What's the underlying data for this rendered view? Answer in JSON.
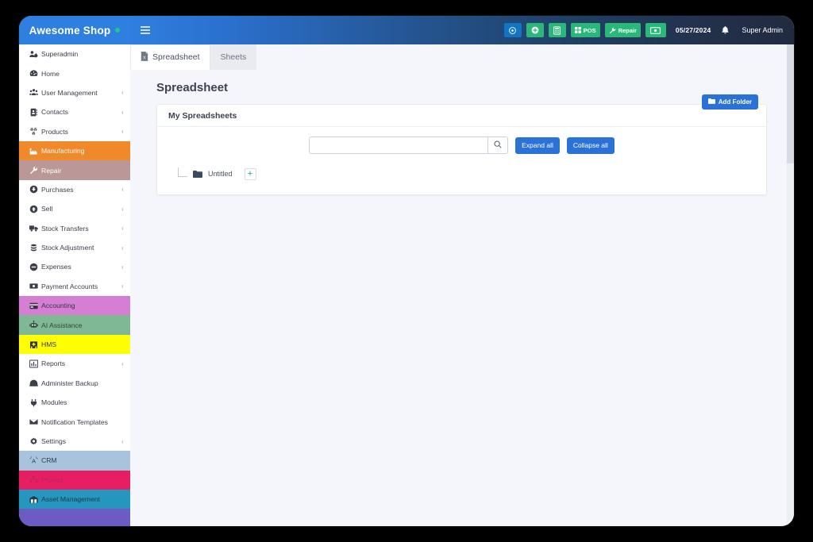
{
  "brand": {
    "name": "Awesome Shop",
    "status_dot": "online-dot"
  },
  "navbar": {
    "hamburger_icon": "hamburger-icon",
    "buttons": [
      {
        "id": "calendar-event",
        "label": "",
        "icon": "clock-circle-icon",
        "color": "#1275c4"
      },
      {
        "id": "add-new",
        "label": "",
        "icon": "plus-circle-icon",
        "color": "#28b978"
      },
      {
        "id": "calculator",
        "label": "",
        "icon": "calculator-icon",
        "color": "#28b978"
      },
      {
        "id": "pos",
        "label": "POS",
        "icon": "grid-icon",
        "color": "#28b978"
      },
      {
        "id": "repair",
        "label": "Repair",
        "icon": "wrench-icon",
        "color": "#28b978"
      },
      {
        "id": "cash-register",
        "label": "",
        "icon": "money-bill-icon",
        "color": "#28b978"
      }
    ],
    "date": "05/27/2024",
    "bell_icon": "bell-icon",
    "user": "Super Admin"
  },
  "sidebar": {
    "items": [
      {
        "label": "Superadmin",
        "icon": "users-cog-icon",
        "caret": false,
        "bg": "#ffffff",
        "fg": "#3b3f4a"
      },
      {
        "label": "Home",
        "icon": "tachometer-icon",
        "caret": false,
        "bg": "#ffffff",
        "fg": "#3b3f4a"
      },
      {
        "label": "User Management",
        "icon": "users-icon",
        "caret": true,
        "bg": "#ffffff",
        "fg": "#3b3f4a"
      },
      {
        "label": "Contacts",
        "icon": "address-book-icon",
        "caret": true,
        "bg": "#ffffff",
        "fg": "#3b3f4a"
      },
      {
        "label": "Products",
        "icon": "cubes-icon",
        "caret": true,
        "bg": "#ffffff",
        "fg": "#3b3f4a"
      },
      {
        "label": "Manufacturing",
        "icon": "industry-icon",
        "caret": false,
        "bg": "#f0892a",
        "fg": "#ffffff"
      },
      {
        "label": "Repair",
        "icon": "wrench-icon",
        "caret": false,
        "bg": "#bb9797",
        "fg": "#ffffff"
      },
      {
        "label": "Purchases",
        "icon": "arrow-down-circle-icon",
        "caret": true,
        "bg": "#ffffff",
        "fg": "#3b3f4a"
      },
      {
        "label": "Sell",
        "icon": "arrow-up-circle-icon",
        "caret": true,
        "bg": "#ffffff",
        "fg": "#3b3f4a"
      },
      {
        "label": "Stock Transfers",
        "icon": "truck-icon",
        "caret": true,
        "bg": "#ffffff",
        "fg": "#3b3f4a"
      },
      {
        "label": "Stock Adjustment",
        "icon": "database-icon",
        "caret": true,
        "bg": "#ffffff",
        "fg": "#3b3f4a"
      },
      {
        "label": "Expenses",
        "icon": "minus-circle-icon",
        "caret": true,
        "bg": "#ffffff",
        "fg": "#3b3f4a"
      },
      {
        "label": "Payment Accounts",
        "icon": "money-bill-icon",
        "caret": true,
        "bg": "#ffffff",
        "fg": "#3b3f4a"
      },
      {
        "label": "Accounting",
        "icon": "credit-card-icon",
        "caret": false,
        "bg": "#d47fd4",
        "fg": "#3f2f46"
      },
      {
        "label": "AI Assistance",
        "icon": "robot-icon",
        "caret": false,
        "bg": "#7fb894",
        "fg": "#34483c"
      },
      {
        "label": "HMS",
        "icon": "hospital-icon",
        "caret": false,
        "bg": "#ffff00",
        "fg": "#2f3542"
      },
      {
        "label": "Reports",
        "icon": "chart-bar-icon",
        "caret": true,
        "bg": "#ffffff",
        "fg": "#3b3f4a"
      },
      {
        "label": "Administer Backup",
        "icon": "server-icon",
        "caret": false,
        "bg": "#ffffff",
        "fg": "#3b3f4a"
      },
      {
        "label": "Modules",
        "icon": "plug-icon",
        "caret": false,
        "bg": "#ffffff",
        "fg": "#3b3f4a"
      },
      {
        "label": "Notification Templates",
        "icon": "envelope-icon",
        "caret": false,
        "bg": "#ffffff",
        "fg": "#3b3f4a"
      },
      {
        "label": "Settings",
        "icon": "gear-icon",
        "caret": true,
        "bg": "#ffffff",
        "fg": "#3b3f4a"
      },
      {
        "label": "CRM",
        "icon": "broadcast-icon",
        "caret": false,
        "bg": "#a8c4dc",
        "fg": "#2f3c4c"
      },
      {
        "label": "Project",
        "icon": "sitemap-icon",
        "caret": false,
        "bg": "#e81e63",
        "fg": "#b8275c"
      },
      {
        "label": "Asset Management",
        "icon": "warehouse-icon",
        "caret": false,
        "bg": "#2596be",
        "fg": "#1d3b4a"
      },
      {
        "label": "",
        "icon": "",
        "caret": false,
        "bg": "#6b5bc4",
        "fg": "#ffffff"
      }
    ]
  },
  "tabs": [
    {
      "label": "Spreadsheet",
      "icon": "file-excel-icon",
      "active": true
    },
    {
      "label": "Sheets",
      "icon": "",
      "active": false
    }
  ],
  "page": {
    "title": "Spreadsheet",
    "card_title": "My Spreadsheets",
    "add_folder_label": "Add Folder",
    "add_folder_icon": "folder-icon",
    "search": {
      "value": "",
      "placeholder": "",
      "icon": "search-icon"
    },
    "expand_all_label": "Expand all",
    "collapse_all_label": "Collapse all",
    "tree": [
      {
        "label": "Untitled",
        "icon": "folder-icon",
        "add_label": "+"
      }
    ]
  },
  "colors": {
    "primary_blue": "#2b72d8",
    "navbar_blue": "#2f7fe0",
    "navbar_navy": "#212b40",
    "success_green": "#28b978",
    "content_bg": "#f4f6fb"
  }
}
